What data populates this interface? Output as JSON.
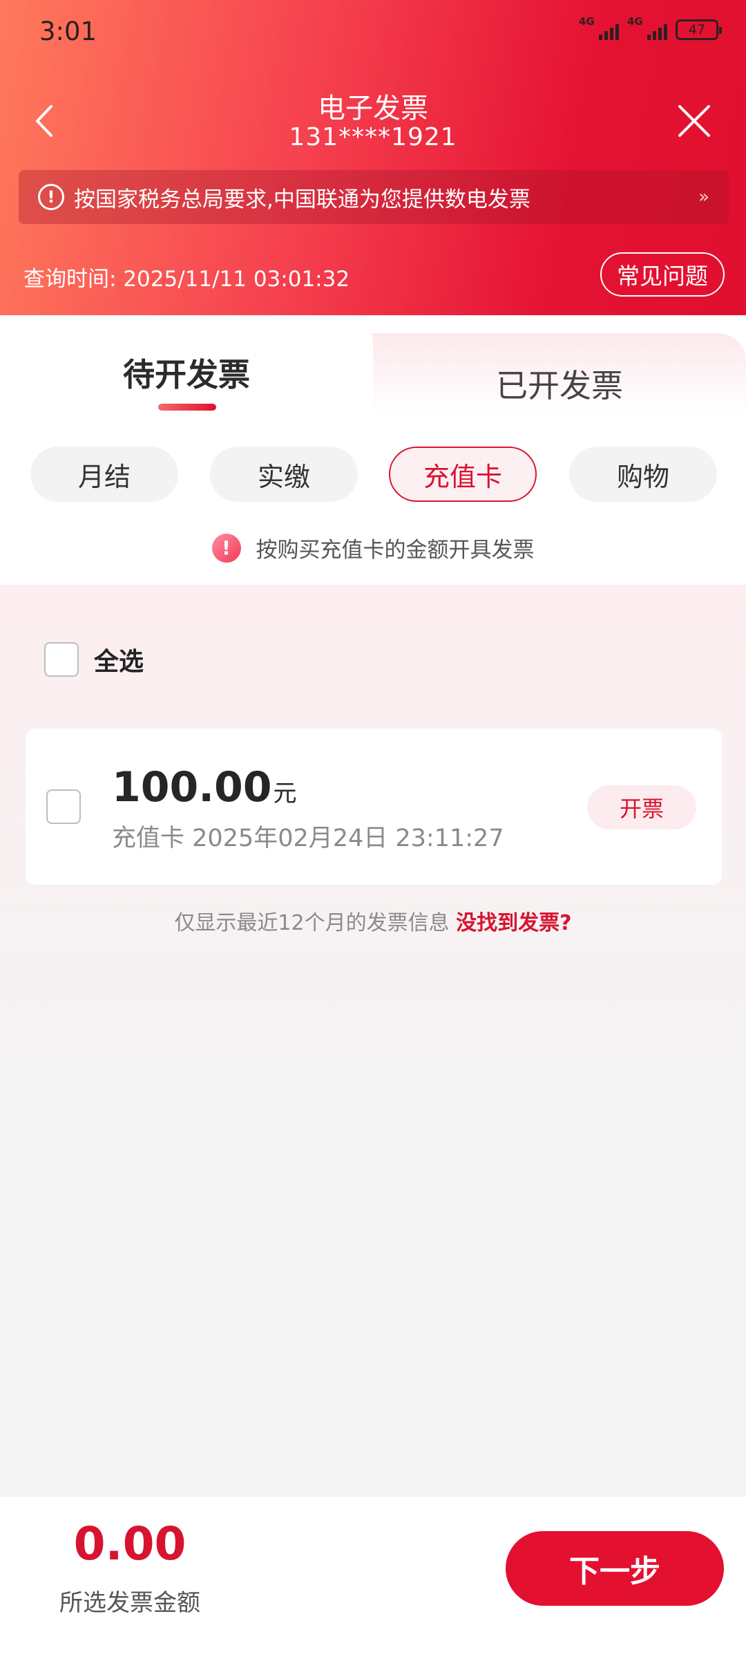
{
  "status_bar": {
    "time": "3:01",
    "signal_1_label": "4G",
    "signal_2_label": "4G",
    "battery": "47"
  },
  "nav": {
    "title": "电子发票",
    "phone": "131****1921"
  },
  "notice": {
    "text": "按国家税务总局要求,中国联通为您提供数电发票",
    "more": "»"
  },
  "query_time": "查询时间: 2025/11/11 03:01:32",
  "faq_label": "常见问题",
  "tabs": [
    {
      "label": "待开发票",
      "active": true
    },
    {
      "label": "已开发票",
      "active": false
    }
  ],
  "chips": [
    {
      "label": "月结"
    },
    {
      "label": "实缴"
    },
    {
      "label": "充值卡"
    },
    {
      "label": "购物"
    }
  ],
  "hint": "按购买充值卡的金额开具发票",
  "select_all_label": "全选",
  "invoices": [
    {
      "amount": "100.00",
      "unit": "元",
      "meta": "充值卡  2025年02月24日 23:11:27",
      "action": "开票"
    }
  ],
  "footer_note": {
    "text": "仅显示最近12个月的发票信息 ",
    "link": "没找到发票?"
  },
  "bottom": {
    "total": "0.00",
    "total_label": "所选发票金额",
    "next_label": "下一步"
  },
  "colors": {
    "brand_red": "#e3102f",
    "accent_text": "#d7142f"
  }
}
